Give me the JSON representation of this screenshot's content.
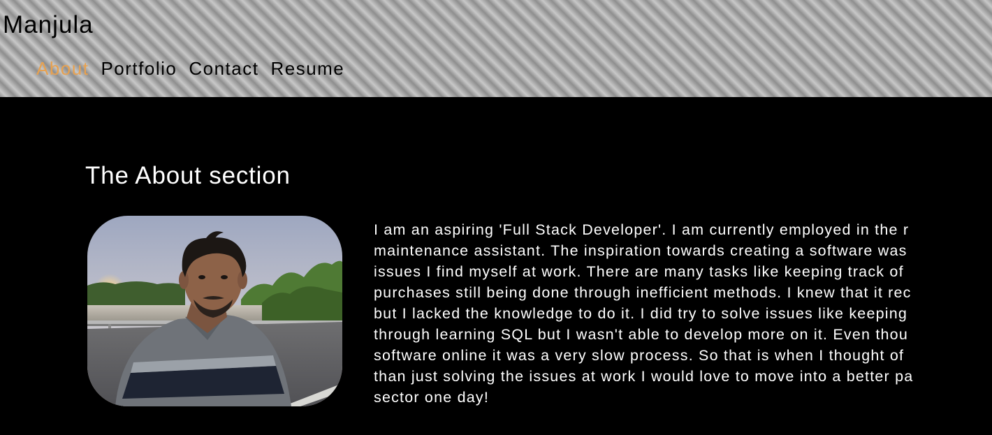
{
  "header": {
    "site_title": "Manjula",
    "nav": {
      "about": "About",
      "portfolio": "Portfolio",
      "contact": "Contact",
      "resume": "Resume"
    },
    "active_color": "#e8a14f"
  },
  "about": {
    "title": "The About section",
    "photo_icon": "profile-photo",
    "lines": [
      "I am an aspiring 'Full Stack Developer'. I am currently employed in the r",
      "maintenance assistant. The inspiration towards creating a software was",
      "issues I find myself at work. There are many tasks like keeping track of",
      "purchases still being done through inefficient methods. I knew that it rec",
      "but I lacked the knowledge to do it. I did try to solve issues like keeping",
      "through learning SQL but I wasn't able to develop more on it. Even thou",
      "software online it was a very slow process. So that is when I thought of",
      "than just solving the issues at work I would love to move into a better pa",
      "sector one day!"
    ]
  }
}
